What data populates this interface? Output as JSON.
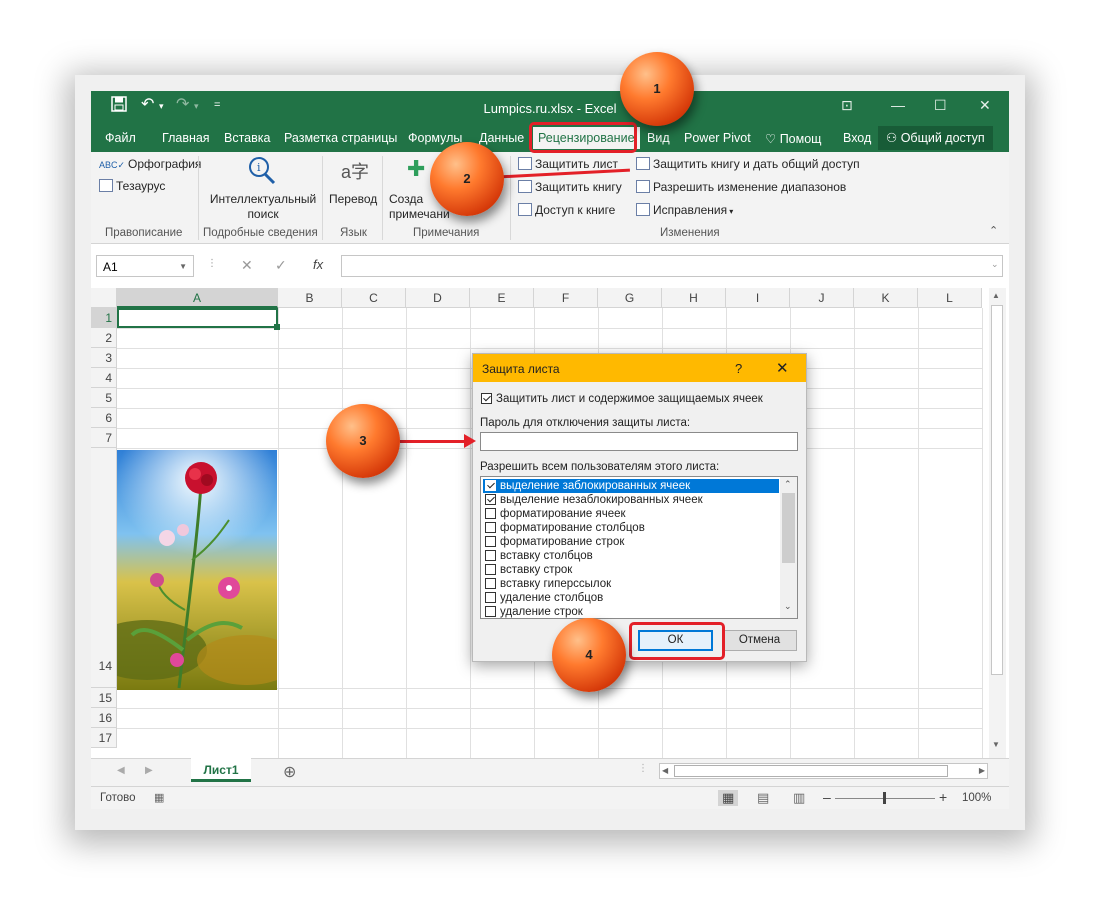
{
  "window": {
    "title": "Lumpics.ru.xlsx - Excel",
    "qa_save_icon": "save-icon",
    "qa_undo_icon": "undo-icon",
    "qa_redo_icon": "redo-icon"
  },
  "tabs": [
    "Файл",
    "Главная",
    "Вставка",
    "Разметка страницы",
    "Формулы",
    "Данные",
    "Рецензирование",
    "Вид",
    "Power Pivot",
    "Помощ",
    "Вход"
  ],
  "share_label": "Общий доступ",
  "ribbon": {
    "spelling": "Орфография",
    "thesaurus": "Тезаурус",
    "group_spelling": "Правописание",
    "smart_lookup_1": "Интеллектуальный",
    "smart_lookup_2": "поиск",
    "group_insights": "Подробные сведения",
    "translate": "Перевод",
    "group_language": "Язык",
    "new_comment_1": "Созда",
    "new_comment_2": "примечани",
    "group_comments": "Примечания",
    "protect_sheet": "Защитить лист",
    "protect_workbook": "Защитить книгу",
    "book_access": "Доступ к книге",
    "protect_share": "Защитить книгу и дать общий доступ",
    "allow_ranges": "Разрешить изменение диапазонов",
    "track_changes": "Исправления",
    "group_changes": "Изменения"
  },
  "formula_bar": {
    "name_box": "A1",
    "fx": "fx",
    "value": ""
  },
  "columns": [
    "A",
    "B",
    "C",
    "D",
    "E",
    "F",
    "G",
    "H",
    "I",
    "J",
    "K",
    "L"
  ],
  "rows": [
    "1",
    "2",
    "3",
    "4",
    "5",
    "6",
    "7",
    "14",
    "15",
    "16",
    "17"
  ],
  "sheet_tab": "Лист1",
  "status": {
    "ready": "Готово",
    "zoom": "100%"
  },
  "dialog": {
    "title": "Защита листа",
    "help": "?",
    "protect_label": "Защитить лист и содержимое защищаемых ячеек",
    "protect_checked": true,
    "password_label": "Пароль для отключения защиты листа:",
    "password_value": "",
    "allow_label": "Разрешить всем пользователям этого листа:",
    "permissions": [
      {
        "label": "выделение заблокированных ячеек",
        "checked": true,
        "selected": true
      },
      {
        "label": "выделение незаблокированных ячеек",
        "checked": true,
        "selected": false
      },
      {
        "label": "форматирование ячеек",
        "checked": false,
        "selected": false
      },
      {
        "label": "форматирование столбцов",
        "checked": false,
        "selected": false
      },
      {
        "label": "форматирование строк",
        "checked": false,
        "selected": false
      },
      {
        "label": "вставку столбцов",
        "checked": false,
        "selected": false
      },
      {
        "label": "вставку строк",
        "checked": false,
        "selected": false
      },
      {
        "label": "вставку гиперссылок",
        "checked": false,
        "selected": false
      },
      {
        "label": "удаление столбцов",
        "checked": false,
        "selected": false
      },
      {
        "label": "удаление строк",
        "checked": false,
        "selected": false
      }
    ],
    "ok": "ОК",
    "cancel": "Отмена"
  },
  "markers": [
    "1",
    "2",
    "3",
    "4"
  ],
  "colors": {
    "excel_green": "#217346",
    "dialog_title": "#ffb900",
    "highlight": "#e32028",
    "selection": "#0078d7"
  }
}
